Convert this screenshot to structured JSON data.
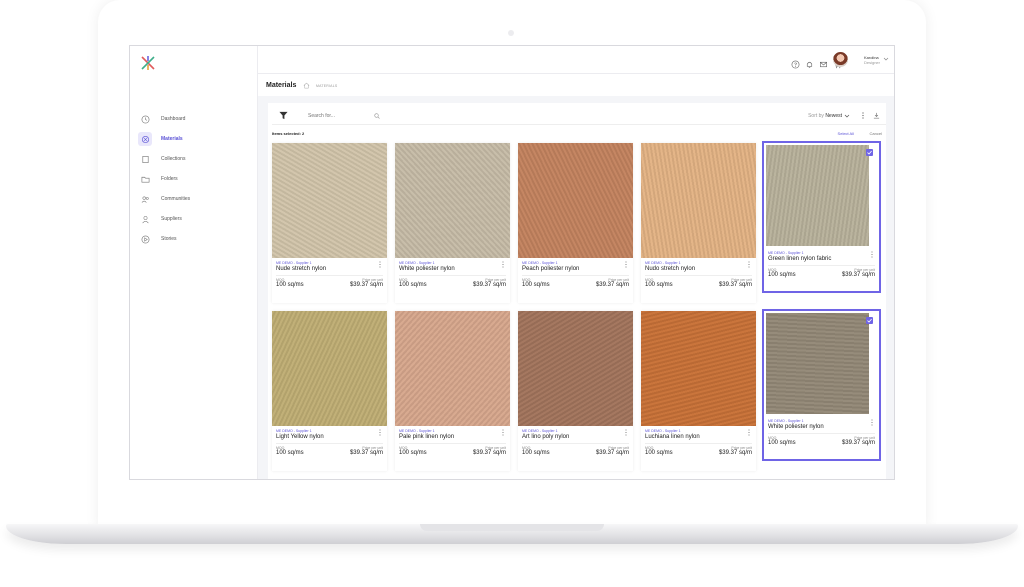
{
  "app": {
    "user_name": "Karolina",
    "user_role": "Designer"
  },
  "nav": [
    {
      "label": "Dashboard",
      "icon": "clock-icon"
    },
    {
      "label": "Materials",
      "icon": "materials-icon",
      "active": true
    },
    {
      "label": "Collections",
      "icon": "collections-icon"
    },
    {
      "label": "Folders",
      "icon": "folder-icon"
    },
    {
      "label": "Communities",
      "icon": "people-icon"
    },
    {
      "label": "Suppliers",
      "icon": "person-icon"
    },
    {
      "label": "Stories",
      "icon": "stories-icon"
    }
  ],
  "page": {
    "title": "Materials",
    "breadcrumb": "MATERIALS"
  },
  "toolbar": {
    "search_placeholder": "Search for...",
    "sort_prefix": "Sort by",
    "sort_value": "Newest"
  },
  "selection": {
    "count_text": "Items selected: 2",
    "select_all": "Select All",
    "cancel": "Cancel"
  },
  "labels": {
    "moq": "MOQ",
    "price": "Price per unit"
  },
  "materials": [
    {
      "supplier": "ME DEMO - Supplier 1",
      "name": "Nude stretch nylon",
      "moq": "100 sq/ms",
      "price": "$39.37 sq/m",
      "selected": false,
      "color": "#e3dccd"
    },
    {
      "supplier": "ME DEMO - Supplier 1",
      "name": "White poliester nylon",
      "moq": "100 sq/ms",
      "price": "$39.37 sq/m",
      "selected": false,
      "color": "#ddd7cb"
    },
    {
      "supplier": "ME DEMO - Supplier 1",
      "name": "Peach poliester nylon",
      "moq": "100 sq/ms",
      "price": "$39.37 sq/m",
      "selected": false,
      "color": "#dbb49a"
    },
    {
      "supplier": "ME DEMO - Supplier 1",
      "name": "Nudo stretch nylon",
      "moq": "100 sq/ms",
      "price": "$39.37 sq/m",
      "selected": false,
      "color": "#ecd2b5"
    },
    {
      "supplier": "ME DEMO - Supplier 1",
      "name": "Green linen nylon fabric",
      "moq": "100 sq/ms",
      "price": "$39.37 sq/m",
      "selected": true,
      "color": "#d5d1c4"
    },
    {
      "supplier": "ME DEMO - Supplier 1",
      "name": "Light Yellow nylon",
      "moq": "100 sq/ms",
      "price": "$39.37 sq/m",
      "selected": false,
      "color": "#d9cfaa"
    },
    {
      "supplier": "ME DEMO - Supplier 1",
      "name": "Pale pink linen nylon",
      "moq": "100 sq/ms",
      "price": "$39.37 sq/m",
      "selected": false,
      "color": "#e6cbbb"
    },
    {
      "supplier": "ME DEMO - Supplier 1",
      "name": "Art lino poly nylon",
      "moq": "100 sq/ms",
      "price": "$39.37 sq/m",
      "selected": false,
      "color": "#c8aa98"
    },
    {
      "supplier": "ME DEMO - Supplier 1",
      "name": "Luchiana linen nylon",
      "moq": "100 sq/ms",
      "price": "$39.37 sq/m",
      "selected": false,
      "color": "#dea877"
    },
    {
      "supplier": "ME DEMO - Supplier 1",
      "name": "White poliester nylon",
      "moq": "100 sq/ms",
      "price": "$39.37 sq/m",
      "selected": true,
      "color": "#bfb8ac"
    }
  ]
}
